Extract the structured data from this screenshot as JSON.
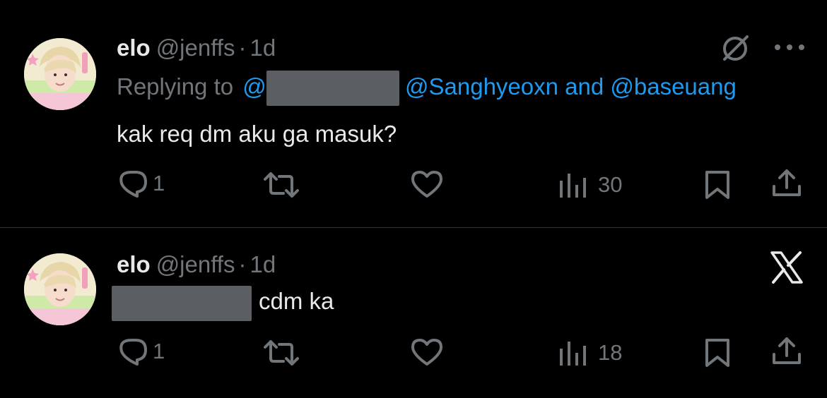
{
  "tweets": [
    {
      "author": {
        "name": "elo",
        "handle": "@jenffs",
        "separator": "·",
        "time": "1d"
      },
      "replying": {
        "prefix": "Replying to",
        "at_fragment": "@",
        "mentions": "@Sanghyeoxn and @baseuang"
      },
      "text": "kak req dm aku ga masuk?",
      "actions": {
        "replies": "1",
        "views": "30"
      },
      "top_icons": [
        "grok-icon",
        "more-icon"
      ]
    },
    {
      "author": {
        "name": "elo",
        "handle": "@jenffs",
        "separator": "·",
        "time": "1d"
      },
      "text": "cdm ka",
      "actions": {
        "replies": "1",
        "views": "18"
      },
      "top_icons": [
        "x-logo-icon"
      ]
    }
  ],
  "colors": {
    "background": "#000000",
    "text_primary": "#e7e9ea",
    "text_secondary": "#71767b",
    "mention": "#1d9bf0",
    "divider": "#2f3336",
    "redaction": "#5b5f63"
  }
}
